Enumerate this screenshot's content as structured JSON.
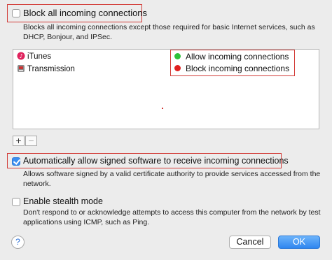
{
  "block_all": {
    "label": "Block all incoming connections",
    "checked": false,
    "desc_line1": "Blocks all incoming connections except those required for basic Internet services,  such as",
    "desc_line2": "DHCP, Bonjour, and IPSec."
  },
  "apps": [
    {
      "name": "iTunes",
      "icon": "itunes-icon"
    },
    {
      "name": "Transmission",
      "icon": "transmission-icon"
    }
  ],
  "connection_menu": {
    "items": [
      {
        "label": "Allow incoming connections",
        "color": "#2ec23a"
      },
      {
        "label": "Block incoming connections",
        "color": "#e02020"
      }
    ]
  },
  "list_controls": {
    "add": "+",
    "remove": "−"
  },
  "auto_allow": {
    "label": "Automatically allow signed software to receive incoming connections",
    "checked": true,
    "desc_line1": "Allows software signed by a valid certificate authority to provide services accessed from the",
    "desc_line2": "network."
  },
  "stealth": {
    "label": "Enable stealth mode",
    "checked": false,
    "desc_line1": "Don't respond to or acknowledge attempts to access this computer from the network by test",
    "desc_line2": "applications using ICMP, such as Ping."
  },
  "buttons": {
    "help": "?",
    "cancel": "Cancel",
    "ok": "OK"
  },
  "colors": {
    "accent": "#3b8ef0",
    "highlight": "#d23a36"
  }
}
